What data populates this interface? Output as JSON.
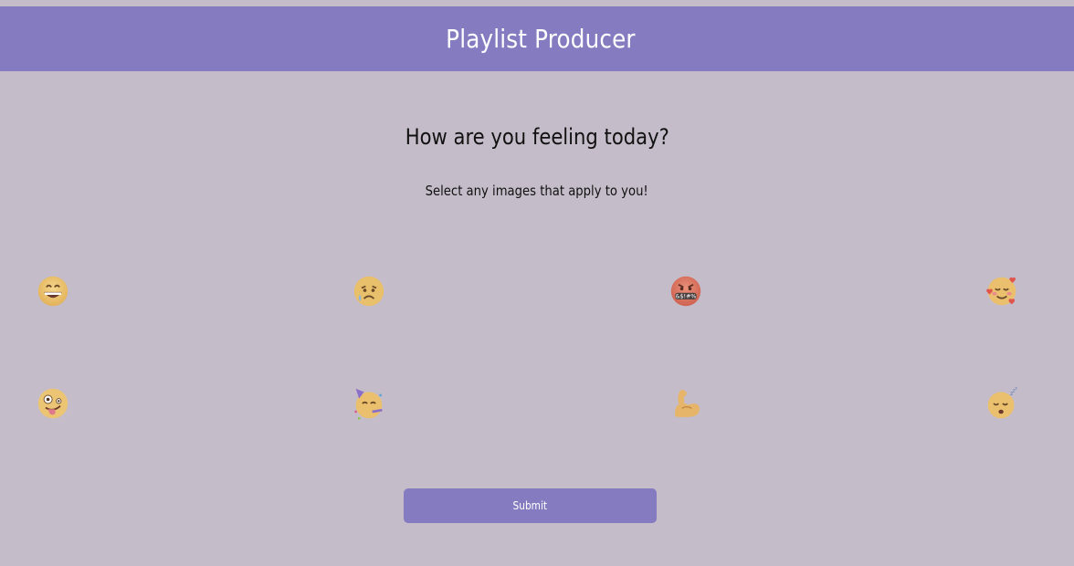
{
  "header": {
    "title": "Playlist Producer"
  },
  "main": {
    "question": "How are you feeling today?",
    "subtitle": "Select any images that apply to you!"
  },
  "emojis": [
    {
      "name": "grinning-face-icon",
      "label": "happy"
    },
    {
      "name": "sad-sweat-face-icon",
      "label": "sad"
    },
    {
      "name": "cursing-face-icon",
      "label": "angry"
    },
    {
      "name": "smiling-face-hearts-icon",
      "label": "loved"
    },
    {
      "name": "zany-face-icon",
      "label": "silly"
    },
    {
      "name": "partying-face-icon",
      "label": "party"
    },
    {
      "name": "flexed-biceps-icon",
      "label": "strong"
    },
    {
      "name": "sleeping-face-icon",
      "label": "sleepy"
    }
  ],
  "submit": {
    "label": "Submit"
  },
  "colors": {
    "background": "#c4bcc8",
    "accent": "#857bc0",
    "text": "#111111"
  }
}
